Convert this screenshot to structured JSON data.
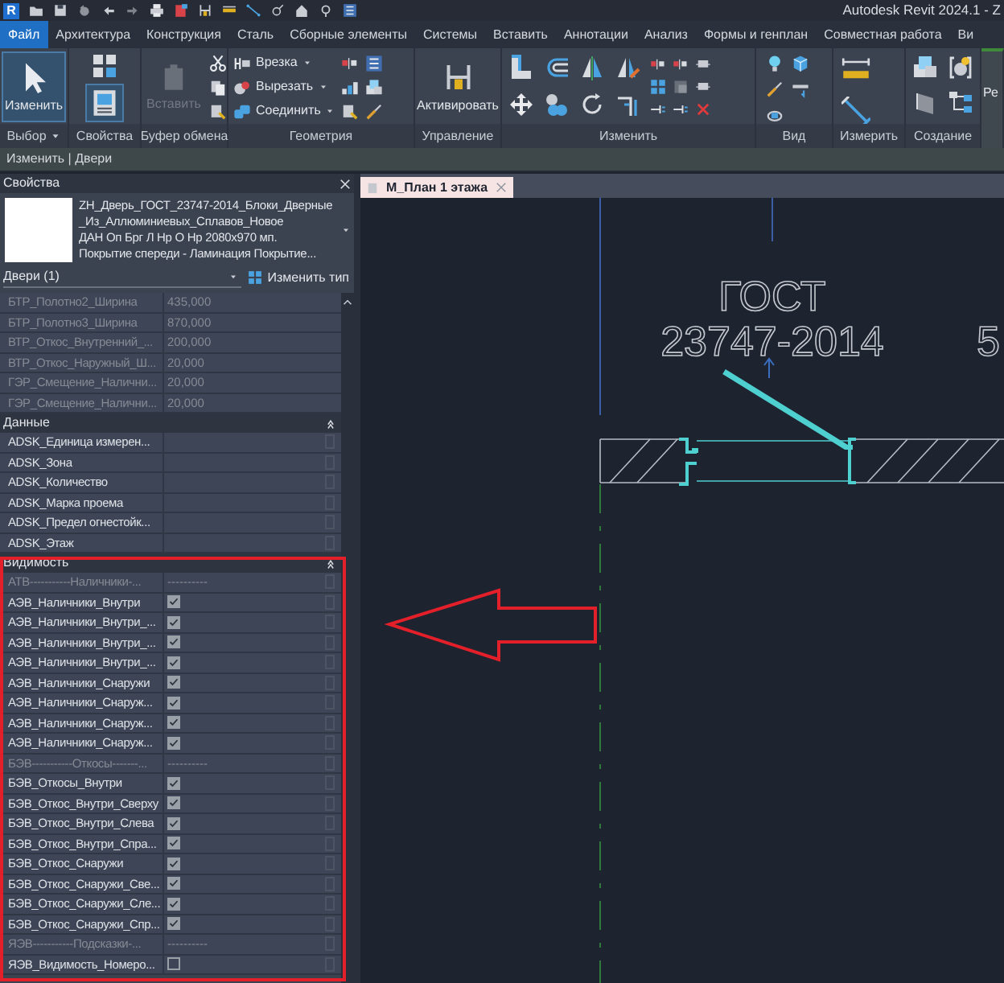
{
  "window": {
    "title": "Autodesk Revit 2024.1 - Z",
    "app_logo": "R"
  },
  "tabs": [
    {
      "label": "Файл",
      "selected": true
    },
    {
      "label": "Архитектура",
      "selected": false
    },
    {
      "label": "Конструкция",
      "selected": false
    },
    {
      "label": "Сталь",
      "selected": false
    },
    {
      "label": "Сборные элементы",
      "selected": false
    },
    {
      "label": "Системы",
      "selected": false
    },
    {
      "label": "Вставить",
      "selected": false
    },
    {
      "label": "Аннотации",
      "selected": false
    },
    {
      "label": "Анализ",
      "selected": false
    },
    {
      "label": "Формы и генплан",
      "selected": false
    },
    {
      "label": "Совместная работа",
      "selected": false
    },
    {
      "label": "Ви",
      "selected": false
    }
  ],
  "ribbon": [
    {
      "kind": "select",
      "label": "Выбор",
      "menu": true,
      "buttons": [
        {
          "label": "Изменить",
          "selected": true
        }
      ]
    },
    {
      "kind": "properties",
      "label": "Свойства",
      "palette_on": true
    },
    {
      "kind": "clipboard",
      "label": "Буфер обмена",
      "buttons": [
        {
          "label": "Вставить",
          "disabled": true
        }
      ]
    },
    {
      "kind": "geometry",
      "label": "Геометрия",
      "buttons": [
        {
          "label": "Врезка"
        },
        {
          "label": "Вырезать"
        },
        {
          "label": "Соединить"
        }
      ]
    },
    {
      "kind": "control",
      "label": "Управление",
      "buttons": [
        {
          "label": "Активировать"
        }
      ]
    },
    {
      "kind": "modify",
      "label": "Изменить"
    },
    {
      "kind": "view",
      "label": "Вид"
    },
    {
      "kind": "measure",
      "label": "Измерить"
    },
    {
      "kind": "create",
      "label": "Создание"
    },
    {
      "kind": "partial",
      "buttons": [
        {
          "label": "Ре"
        }
      ]
    }
  ],
  "context_bar": {
    "label": "Изменить | Двери"
  },
  "properties": {
    "title": "Свойства",
    "type_selector": {
      "lines": [
        "ZH_Дверь_ГОСТ_23747-2014_Блоки_Дверные",
        "_Из_Аллюминиевых_Сплавов_Новое",
        "ДАН Оп Брг Л Нр О Нр 2080x970  мп.",
        "Покрытие спереди - Ламинация Покрытие..."
      ]
    },
    "filter": "Двери (1)",
    "edit_type": "Изменить тип",
    "groups": [
      {
        "rows": [
          {
            "kind": "value",
            "name": "БТР_Полотно2_Ширина",
            "value": "435,000",
            "disabled": true
          },
          {
            "kind": "value",
            "name": "БТР_Полотно3_Ширина",
            "value": "870,000",
            "disabled": true
          },
          {
            "kind": "value",
            "name": "ВТР_Откос_Внутренний_...",
            "value": "200,000",
            "disabled": true
          },
          {
            "kind": "value",
            "name": "ВТР_Откос_Наружный_Ш...",
            "value": "20,000",
            "disabled": true
          },
          {
            "kind": "value",
            "name": "ГЭР_Смещение_Налични...",
            "value": "20,000",
            "disabled": true
          },
          {
            "kind": "value",
            "name": "ГЭР_Смещение_Налични...",
            "value": "20,000",
            "disabled": true
          }
        ]
      },
      {
        "header": "Данные",
        "link_buttons": true,
        "rows": [
          {
            "kind": "value",
            "name": "ADSK_Единица измерен...",
            "disabled": false
          },
          {
            "kind": "value",
            "name": "ADSK_Зона",
            "disabled": false
          },
          {
            "kind": "value",
            "name": "ADSK_Количество",
            "disabled": false
          },
          {
            "kind": "value",
            "name": "ADSK_Марка проема",
            "disabled": false
          },
          {
            "kind": "value",
            "name": "ADSK_Предел огнестойк...",
            "disabled": false
          },
          {
            "kind": "value",
            "name": "ADSK_Этаж",
            "disabled": false
          }
        ]
      },
      {
        "header": "Видимость",
        "link_buttons": true,
        "rows": [
          {
            "kind": "separator",
            "name": "АТВ-----------Наличники-...",
            "value": "----------"
          },
          {
            "kind": "check",
            "name": "АЭВ_Наличники_Внутри",
            "checked": true
          },
          {
            "kind": "check",
            "name": "АЭВ_Наличники_Внутри_...",
            "checked": true
          },
          {
            "kind": "check",
            "name": "АЭВ_Наличники_Внутри_...",
            "checked": true
          },
          {
            "kind": "check",
            "name": "АЭВ_Наличники_Внутри_...",
            "checked": true
          },
          {
            "kind": "check",
            "name": "АЭВ_Наличники_Снаружи",
            "checked": true
          },
          {
            "kind": "check",
            "name": "АЭВ_Наличники_Снаруж...",
            "checked": true
          },
          {
            "kind": "check",
            "name": "АЭВ_Наличники_Снаруж...",
            "checked": true
          },
          {
            "kind": "check",
            "name": "АЭВ_Наличники_Снаруж...",
            "checked": true
          },
          {
            "kind": "separator",
            "name": "БЭВ-----------Откосы-------...",
            "value": "----------"
          },
          {
            "kind": "check",
            "name": "БЭВ_Откосы_Внутри",
            "checked": true
          },
          {
            "kind": "check",
            "name": "БЭВ_Откос_Внутри_Сверху",
            "checked": true
          },
          {
            "kind": "check",
            "name": "БЭВ_Откос_Внутри_Слева",
            "checked": true
          },
          {
            "kind": "check",
            "name": "БЭВ_Откос_Внутри_Спра...",
            "checked": true
          },
          {
            "kind": "check",
            "name": "БЭВ_Откос_Снаружи",
            "checked": true
          },
          {
            "kind": "check",
            "name": "БЭВ_Откос_Снаружи_Све...",
            "checked": true
          },
          {
            "kind": "check",
            "name": "БЭВ_Откос_Снаружи_Сле...",
            "checked": true
          },
          {
            "kind": "check",
            "name": "БЭВ_Откос_Снаружи_Спр...",
            "checked": true
          },
          {
            "kind": "separator",
            "name": "ЯЭВ-----------Подсказки-...",
            "value": "----------"
          },
          {
            "kind": "check",
            "name": "ЯЭВ_Видимость_Номеро...",
            "checked": false
          }
        ]
      }
    ]
  },
  "view_tabs": [
    {
      "label": "М_План 1 этажа",
      "selected": true
    }
  ],
  "canvas": {
    "tag_lines": [
      "ГОСТ",
      "23747-2014"
    ],
    "edge_text": "5"
  }
}
